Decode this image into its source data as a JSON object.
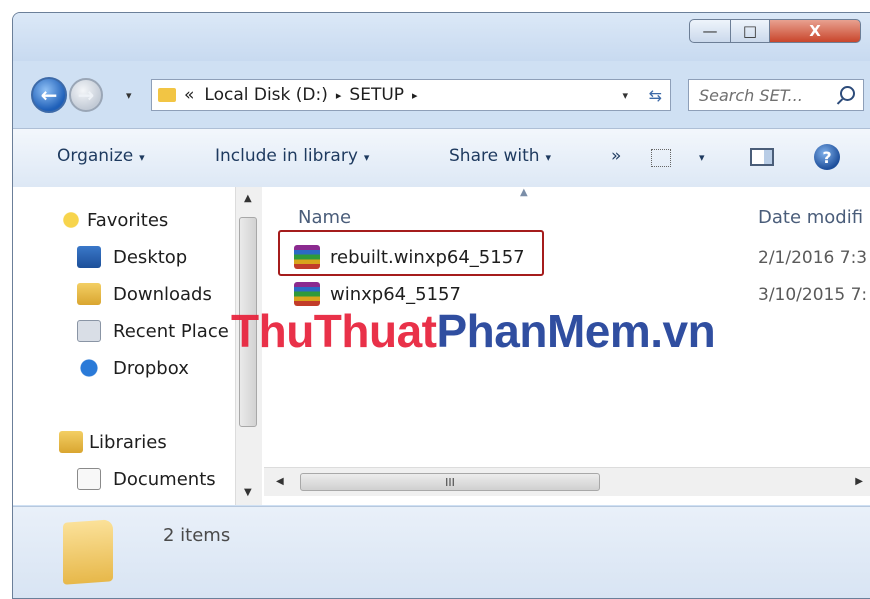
{
  "window": {
    "buttons": {
      "minimize": "—",
      "maximize": "□",
      "close": "X"
    }
  },
  "nav": {
    "back_glyph": "←",
    "forward_glyph": "→",
    "history_dropdown": "▾",
    "breadcrumb": {
      "overflow": "«",
      "items": [
        "Local Disk (D:)",
        "SETUP"
      ],
      "separator": "▸"
    },
    "address_dropdown": "▾",
    "refresh_glyph": "⇆",
    "search_placeholder": "Search SET..."
  },
  "toolbar": {
    "organize": "Organize",
    "include_in_library": "Include in library",
    "share_with": "Share with",
    "more": "»",
    "dropdown_caret": "▾",
    "help": "?"
  },
  "sidebar": {
    "favorites_label": "Favorites",
    "favorites": [
      "Desktop",
      "Downloads",
      "Recent Place",
      "Dropbox"
    ],
    "libraries_label": "Libraries",
    "libraries": [
      "Documents"
    ]
  },
  "file_list": {
    "columns": {
      "name": "Name",
      "date": "Date modifi"
    },
    "files": [
      {
        "name": "rebuilt.winxp64_5157",
        "date": "2/1/2016 7:3",
        "highlighted": true
      },
      {
        "name": "winxp64_5157",
        "date": "3/10/2015 7:",
        "highlighted": false
      }
    ],
    "scroll_grip": "III"
  },
  "details": {
    "item_count": "2 items"
  },
  "watermark": {
    "part1": "ThuThuat",
    "part2": "PhanMem.vn"
  },
  "colors": {
    "accent": "#1e5fb8",
    "highlight_border": "#a51c1c",
    "watermark_red": "#e8203a",
    "watermark_blue": "#1f3f99"
  }
}
